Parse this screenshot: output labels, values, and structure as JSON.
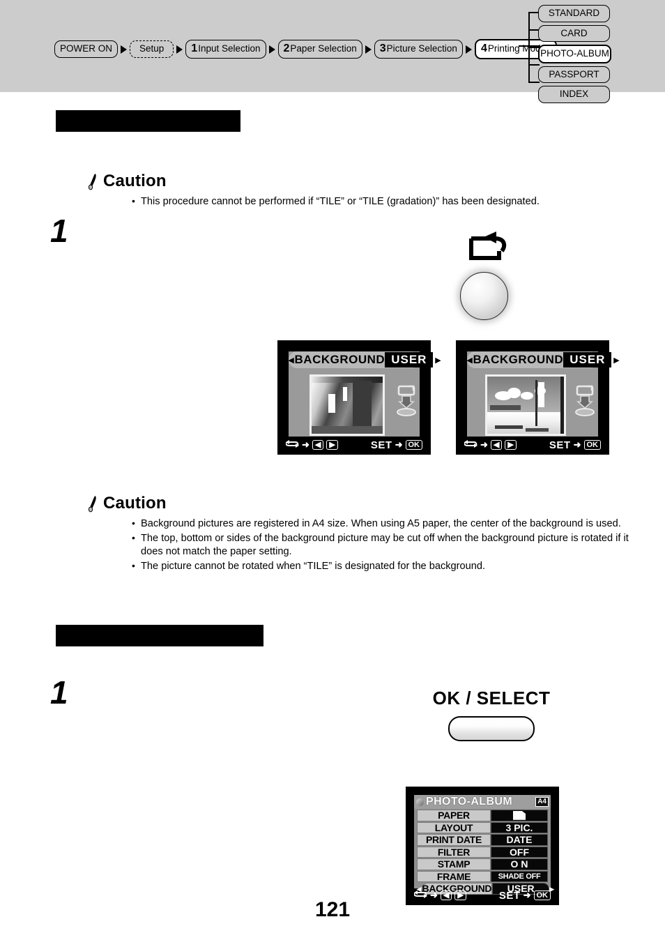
{
  "header": {
    "flow": [
      {
        "label": "POWER ON",
        "num": "",
        "style": "plain"
      },
      {
        "label": "Setup",
        "num": "",
        "style": "dashed"
      },
      {
        "label": "Input Selection",
        "num": "1",
        "style": "plain"
      },
      {
        "label": "Paper Selection",
        "num": "2",
        "style": "plain"
      },
      {
        "label": "Picture Selection",
        "num": "3",
        "style": "plain"
      },
      {
        "label": "Printing Modes",
        "num": "4",
        "style": "active"
      }
    ],
    "modes": [
      {
        "label": "STANDARD",
        "active": false
      },
      {
        "label": "CARD",
        "active": false
      },
      {
        "label": "PHOTO-ALBUM",
        "active": true
      },
      {
        "label": "PASSPORT",
        "active": false
      },
      {
        "label": "INDEX",
        "active": false
      }
    ]
  },
  "section1": {
    "heading": "",
    "step_number": "1",
    "caution": {
      "title": "Caution",
      "items": [
        "This procedure cannot be performed if “TILE” or “TILE (gradation)” has been designated."
      ]
    },
    "button": {
      "icon": "rotate-icon",
      "type": "round-button"
    }
  },
  "section2": {
    "heading": "",
    "step_number": "1",
    "caution": {
      "title": "Caution",
      "items": [
        "Background pictures are registered in A4 size. When using A5 paper, the center of the background is used.",
        "The top, bottom or sides of the background picture may be cut off when the background picture is rotated if it does not match the paper setting.",
        "The picture cannot be rotated when “TILE” is designated for the background."
      ]
    },
    "button": {
      "label": "OK / SELECT",
      "type": "pill-button"
    }
  },
  "lcd_background_before": {
    "title": "BACKGROUND",
    "value": "USER",
    "left_arrow": "◂",
    "right_arrow": "▸",
    "footer": {
      "cycle_icon": "cycle-icon",
      "arrow": "➜",
      "left_key": "◀",
      "right_key": "▶",
      "set_label": "SET",
      "set_arrow": "➜",
      "ok_key": "OK"
    },
    "preview_orientation": "portrait"
  },
  "lcd_background_after": {
    "title": "BACKGROUND",
    "value": "USER",
    "left_arrow": "◂",
    "right_arrow": "▸",
    "footer": {
      "cycle_icon": "cycle-icon",
      "arrow": "➜",
      "left_key": "◀",
      "right_key": "▶",
      "set_label": "SET",
      "set_arrow": "➜",
      "ok_key": "OK"
    },
    "preview_orientation": "landscape"
  },
  "lcd_menu": {
    "title": "PHOTO-ALBUM",
    "badge": "A4",
    "rows": [
      {
        "label": "PAPER",
        "value": "",
        "value_icon": "paper-icon"
      },
      {
        "label": "LAYOUT",
        "value": "3 PIC.",
        "value_icon": ""
      },
      {
        "label": "PRINT DATE",
        "value": "DATE",
        "value_icon": ""
      },
      {
        "label": "FILTER",
        "value": "OFF",
        "value_icon": ""
      },
      {
        "label": "STAMP",
        "value": "O N",
        "value_icon": ""
      },
      {
        "label": "FRAME",
        "value": "SHADE OFF",
        "value_icon": ""
      },
      {
        "label": "BACKGROUND",
        "value": "USER",
        "value_icon": "",
        "selected": true
      }
    ],
    "footer": {
      "cycle_icon": "cycle-icon",
      "arrow": "➜",
      "left_key": "◀",
      "right_key": "▶",
      "set_label": "SET",
      "set_arrow": "➜",
      "ok_key": "OK"
    }
  },
  "page_number": "121"
}
